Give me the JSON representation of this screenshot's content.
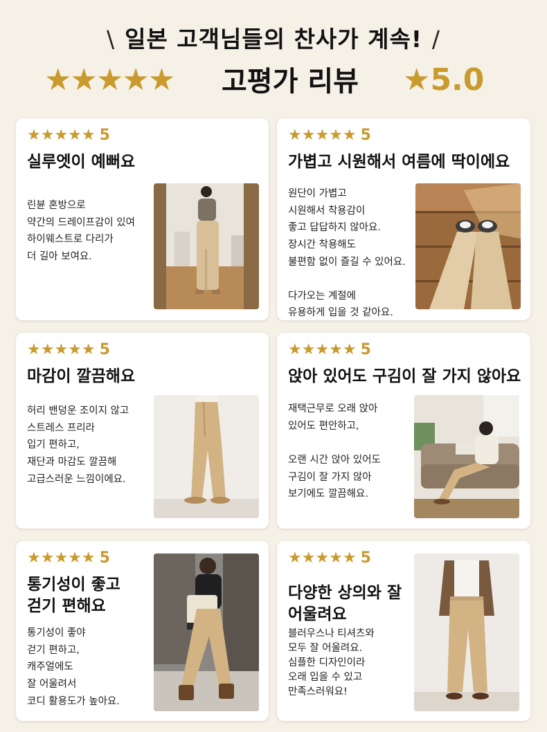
{
  "header": {
    "headline": "일본 고객님들의 찬사가 계속!",
    "slash_left": "\\",
    "slash_right": "/",
    "stars": "★★★★★",
    "review_title": "고평가 리뷰",
    "score": "★5.0"
  },
  "colors": {
    "accent": "#c99a2e",
    "background": "#f6f1e7",
    "card": "#ffffff"
  },
  "reviews": [
    {
      "stars": "★★★★★",
      "rating": "5",
      "title": "실루엣이 예뻐요",
      "body": "린뷴 혼방으로\n약간의 드레이프감이 있여\n하이웨스트로 다리가\n더 길아 보여요.",
      "photo": "mirror-selfie-photo"
    },
    {
      "stars": "★★★★★",
      "rating": "5",
      "title": "가볍고 시원해서 여름에 딱이에요",
      "body": "원단이 가볍고\n시원해서 착용감이\n좋고 답답하지 않아요.\n장시간 착용해도\n불편함 없이 즐길 수 있어요.\n\n다가오는 계절에\n유용하게 입을 것 같아요.",
      "photo": "floor-legs-photo"
    },
    {
      "stars": "★★★★★",
      "rating": "5",
      "title": "마감이 깔끔해요",
      "body": "허리 밴덩운 조이지 않고\n스트레스 프리라\n입기 편하고,\n재단과 마감도 깔끔해\n고급스러운 느낌이에요.",
      "photo": "side-view-photo"
    },
    {
      "stars": "★★★★★",
      "rating": "5",
      "title": "앉아 있어도 구김이 잘 가지 않아요",
      "body": "재택근무로 오래 앉아\n있어도 편안하고,\n\n오랜 시간 앉아 있어도\n구김이 잘 가지 않아\n보기에도 깔끔해요.",
      "photo": "sofa-photo"
    },
    {
      "stars": "★★★★★",
      "rating": "5",
      "title": "통기성이 좋고\n걷기 편해요",
      "body": "통기성이 좋야\n걷기 편하고,\n캐주얼에도\n잘 어울려서\n코디 활용도가 높아요.",
      "photo": "street-walk-photo"
    },
    {
      "stars": "★★★★★",
      "rating": "5",
      "title": "다양한 상의와 잘\n어울려요",
      "body": "블러우스나 티셔츠와\n모두 잘 어울려요.\n심플한 디자인이라\n오래 입을 수 있고\n만족스러워요!",
      "photo": "full-outfit-photo"
    }
  ]
}
